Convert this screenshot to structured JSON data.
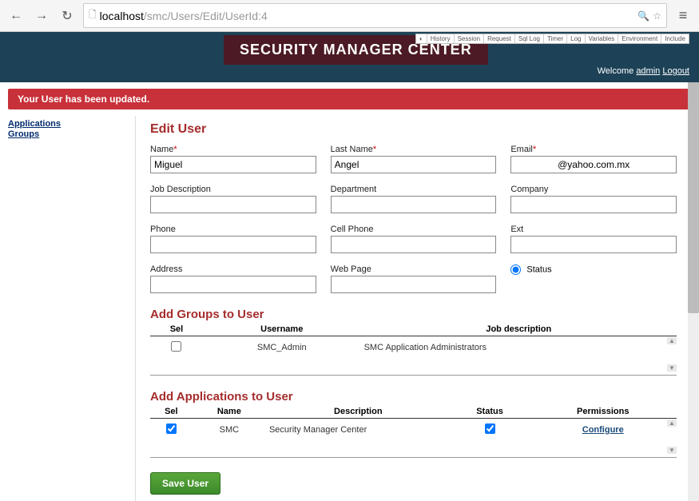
{
  "url": {
    "host": "localhost",
    "path": "/smc/Users/Edit/UserId:4"
  },
  "debug": [
    "History",
    "Session",
    "Request",
    "Sql Log",
    "Timer",
    "Log",
    "Variables",
    "Environment",
    "Include"
  ],
  "header": {
    "title": "SECURITY MANAGER CENTER",
    "welcome": "Welcome ",
    "user": "admin",
    "logout": "Logout"
  },
  "flash": "Your User has been updated.",
  "sidebar": {
    "applications": "Applications",
    "groups": "Groups"
  },
  "page": {
    "title": "Edit User",
    "fields": {
      "name_label": "Name",
      "name_value": "Miguel",
      "lastname_label": "Last Name",
      "lastname_value": "Angel",
      "email_label": "Email",
      "email_value": "@yahoo.com.mx",
      "jobdesc_label": "Job Description",
      "jobdesc_value": "",
      "department_label": "Department",
      "department_value": "",
      "company_label": "Company",
      "company_value": "",
      "phone_label": "Phone",
      "phone_value": "",
      "cellphone_label": "Cell Phone",
      "cellphone_value": "",
      "ext_label": "Ext",
      "ext_value": "",
      "address_label": "Address",
      "address_value": "",
      "webpage_label": "Web Page",
      "webpage_value": "",
      "status_label": "Status"
    },
    "groups_section": {
      "title": "Add Groups to User",
      "headers": [
        "Sel",
        "Username",
        "Job description"
      ],
      "rows": [
        {
          "sel": false,
          "username": "SMC_Admin",
          "jobdesc": "SMC Application Administrators"
        }
      ]
    },
    "apps_section": {
      "title": "Add Applications to User",
      "headers": [
        "Sel",
        "Name",
        "Description",
        "Status",
        "Permissions"
      ],
      "rows": [
        {
          "sel": true,
          "name": "SMC",
          "desc": "Security Manager Center",
          "status": true,
          "perm": "Configure"
        }
      ]
    },
    "save": "Save User"
  }
}
